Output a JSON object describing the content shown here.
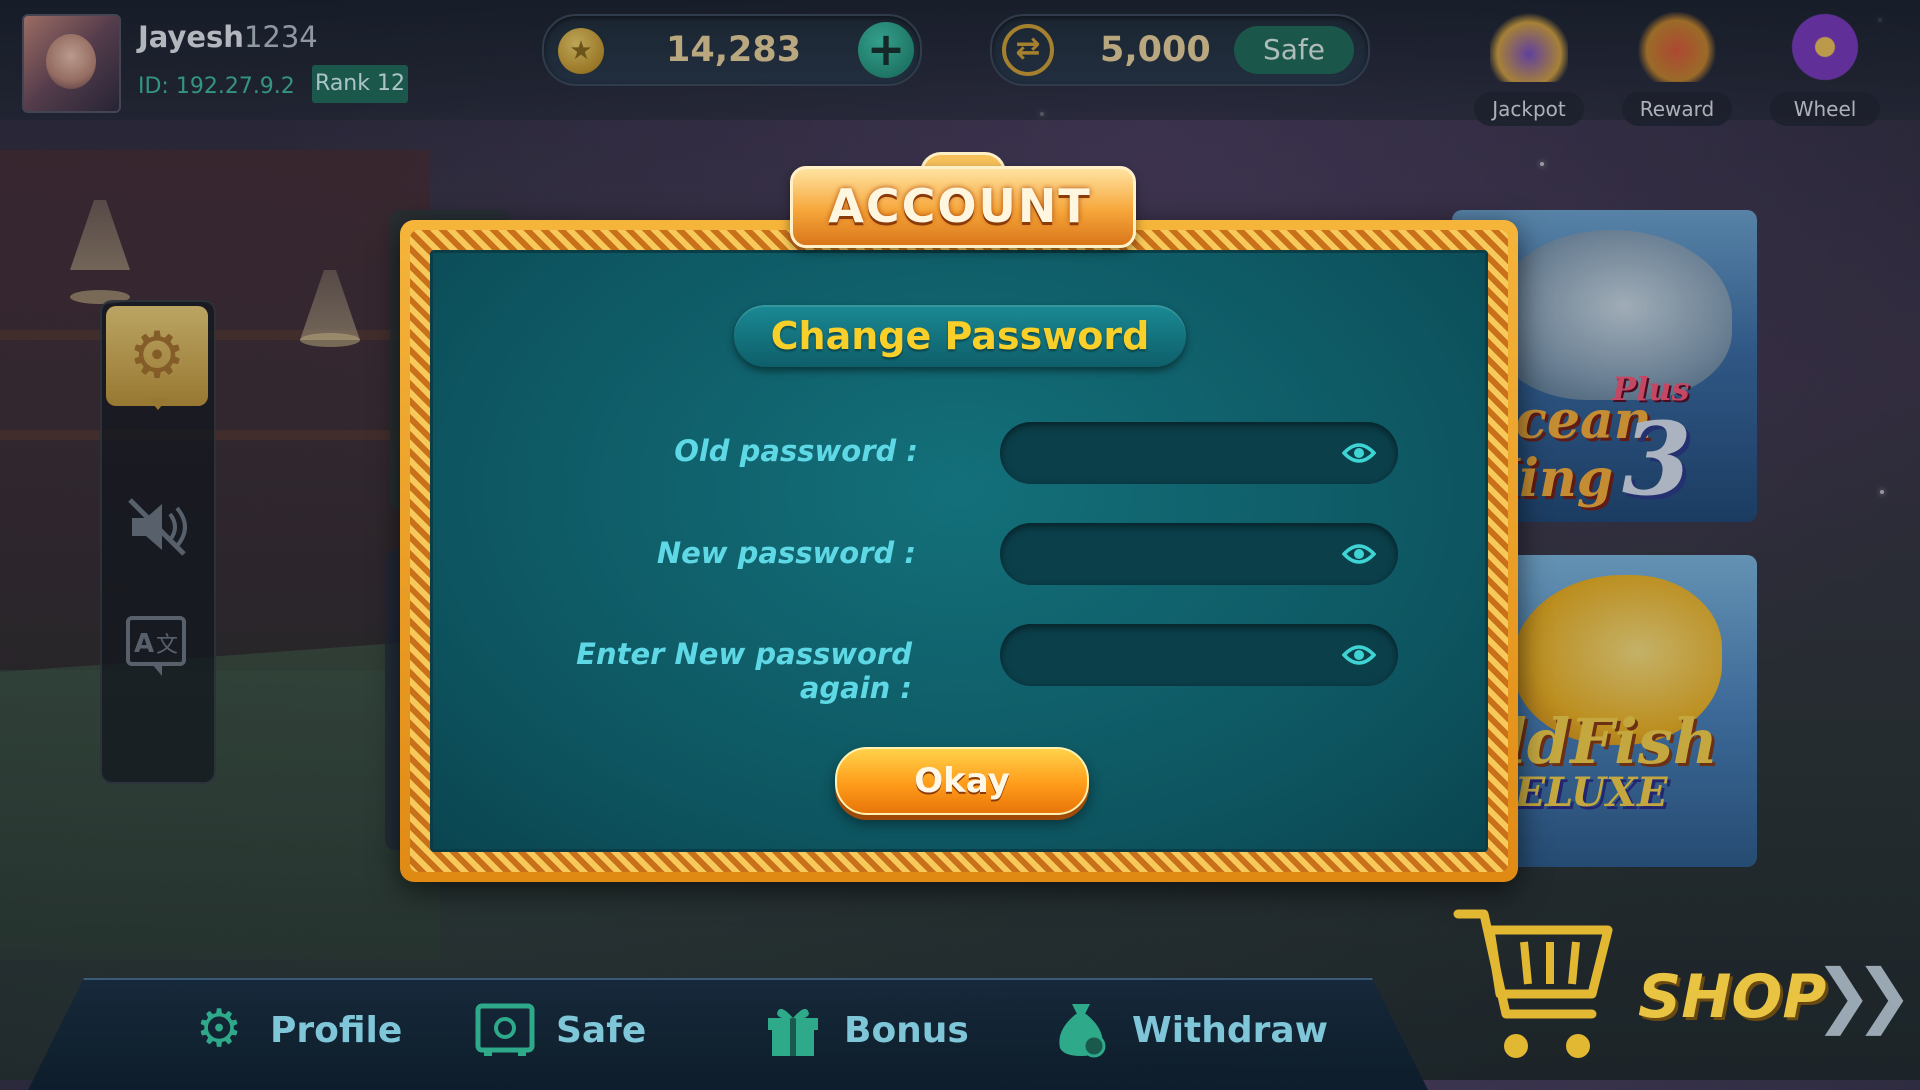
{
  "user": {
    "name": "Jayesh",
    "name_suffix": "1234",
    "id": "ID: 192.27.9.2",
    "rank": "Rank 12"
  },
  "wallet": {
    "coins": "14,283",
    "safe_amount": "5,000",
    "safe_label": "Safe"
  },
  "top_icons": [
    {
      "label": "Jackpot"
    },
    {
      "label": "Reward"
    },
    {
      "label": "Wheel"
    }
  ],
  "modal": {
    "title": "ACCOUNT",
    "subtitle": "Change Password",
    "fields": [
      {
        "label": "Old password :",
        "value": ""
      },
      {
        "label": "New password :",
        "value": ""
      },
      {
        "label": "Enter New password again :",
        "value": ""
      }
    ],
    "okay_label": "Okay"
  },
  "games": {
    "ocean_king": {
      "plus": "Plus",
      "line1": "Ocean",
      "line2": "King",
      "number": "3"
    },
    "gold_fish": {
      "line1": "oldFish",
      "line2": "DELUXE"
    }
  },
  "nav": [
    {
      "label": "Profile",
      "icon": "gear-person-icon"
    },
    {
      "label": "Safe",
      "icon": "safe-icon"
    },
    {
      "label": "Bonus",
      "icon": "gift-icon"
    },
    {
      "label": "Withdraw",
      "icon": "money-bag-icon"
    }
  ],
  "shop": {
    "label": "SHOP"
  },
  "colors": {
    "accent_teal": "#1c6e58",
    "gold": "#f9cf2a",
    "modal_bg": "#0d5560",
    "label_cyan": "#5fd8e6"
  }
}
